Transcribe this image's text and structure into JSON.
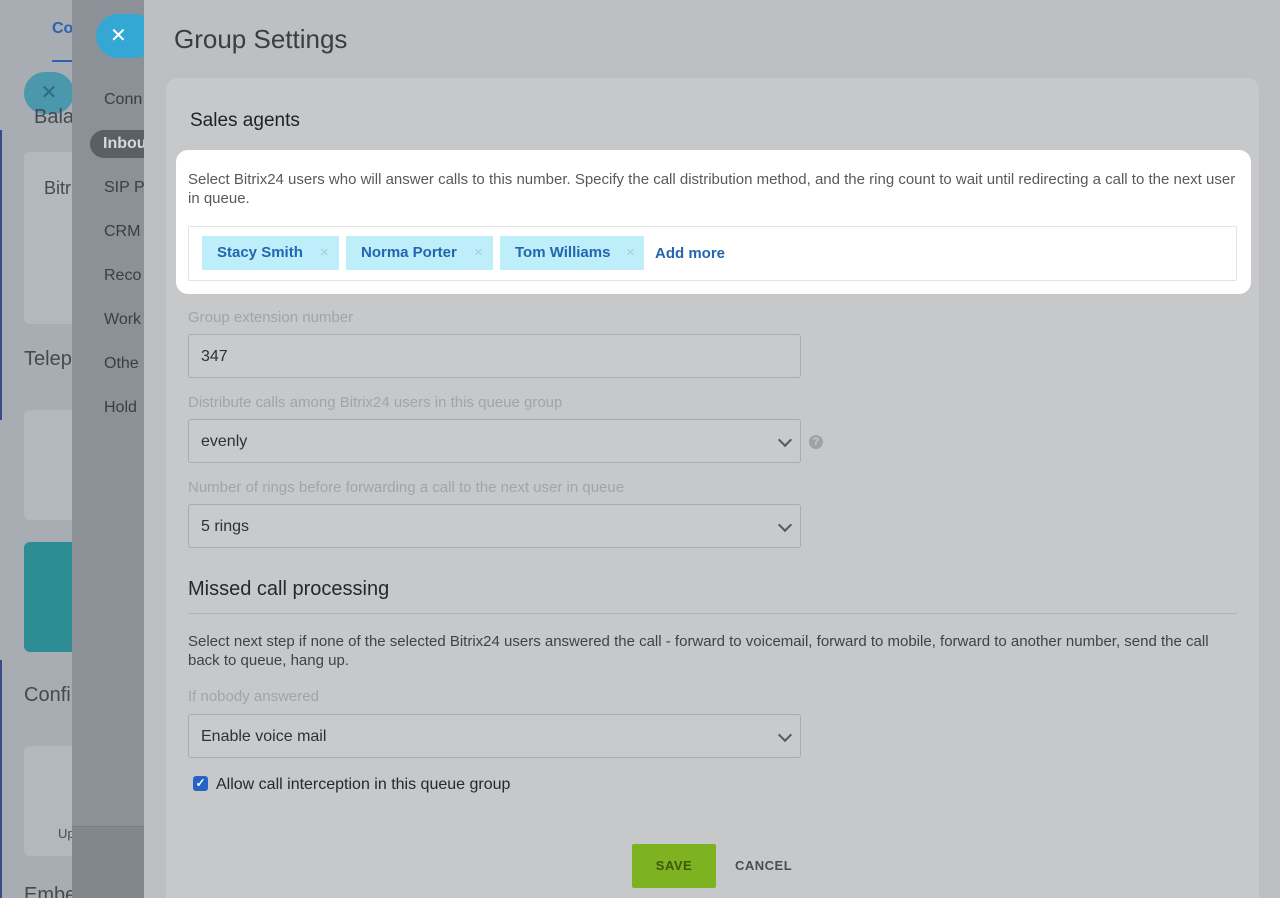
{
  "background": {
    "page_tab": "Co",
    "page_texts": [
      "Bala",
      "Bitr",
      "Telep",
      "Confi",
      "Up",
      "Embe"
    ],
    "slider_items": [
      "Conn",
      "Inbou",
      "SIP P",
      "CRM",
      "Reco",
      "Work",
      "Othe",
      "Hold"
    ],
    "active_item": "Inbou",
    "close_glyph": "✕"
  },
  "slider": {
    "title": "Group Settings",
    "section_title": "Sales agents",
    "agents": {
      "description": "Select Bitrix24 users who will answer calls to this number. Specify the call distribution method, and the ring count to wait until redirecting a call to the next user in queue.",
      "tags": [
        "Stacy Smith",
        "Norma Porter",
        "Tom Williams"
      ],
      "remove_glyph": "×",
      "add_more": "Add more"
    },
    "extension": {
      "label": "Group extension number",
      "value": "347"
    },
    "distribution": {
      "label": "Distribute calls among Bitrix24 users in this queue group",
      "value": "evenly",
      "help_glyph": "?"
    },
    "rings": {
      "label": "Number of rings before forwarding a call to the next user in queue",
      "value": "5 rings"
    },
    "missed": {
      "title": "Missed call processing",
      "description": "Select next step if none of the selected Bitrix24 users answered the call - forward to voicemail, forward to mobile, forward to another number, send the call back to queue, hang up.",
      "if_label": "If nobody answered",
      "if_value": "Enable voice mail"
    },
    "interception": {
      "label": "Allow call interception in this queue group",
      "checked": true,
      "glyph": "✓"
    },
    "buttons": {
      "save": "SAVE",
      "cancel": "CANCEL"
    },
    "colors": {
      "save_green": "#7fb220",
      "link_blue": "#2267ad",
      "tag_bg": "#bfeefb",
      "close_blue": "#35a7d5"
    }
  }
}
